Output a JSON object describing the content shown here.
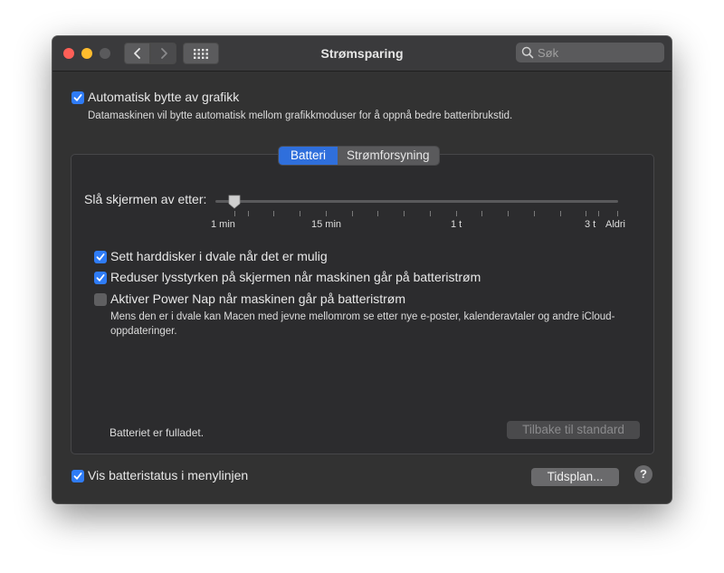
{
  "window": {
    "title": "Strømsparing",
    "search_placeholder": "Søk"
  },
  "auto_graphics": {
    "checked": true,
    "label": "Automatisk bytte av grafikk",
    "description": "Datamaskinen vil bytte automatisk mellom grafikkmoduser for å oppnå bedre batteribrukstid."
  },
  "tabs": [
    {
      "label": "Batteri",
      "active": true
    },
    {
      "label": "Strømforsyning",
      "active": false
    }
  ],
  "display_sleep": {
    "label": "Slå skjermen av etter:",
    "value": "1 min",
    "tick_labels": [
      "1 min",
      "15 min",
      "1 t",
      "3 t",
      "Aldri"
    ]
  },
  "options": [
    {
      "checked": true,
      "label": "Sett harddisker i dvale når det er mulig"
    },
    {
      "checked": true,
      "label": "Reduser lysstyrken på skjermen når maskinen går på batteristrøm"
    },
    {
      "checked": false,
      "label": "Aktiver Power Nap når maskinen går på batteristrøm"
    }
  ],
  "power_nap_description": "Mens den er i dvale kan Macen med jevne mellomrom se etter nye e-poster, kalenderavtaler og andre iCloud-oppdateringer.",
  "battery_status": "Batteriet er fulladet.",
  "restore_defaults_label": "Tilbake til standard",
  "show_battery_status": {
    "checked": true,
    "label": "Vis batteristatus i menylinjen"
  },
  "schedule_label": "Tidsplan...",
  "help_label": "?",
  "colors": {
    "accent": "#2f7cf6",
    "window_bg": "#323232",
    "close": "#fe5f57",
    "minimize": "#febc2e"
  }
}
